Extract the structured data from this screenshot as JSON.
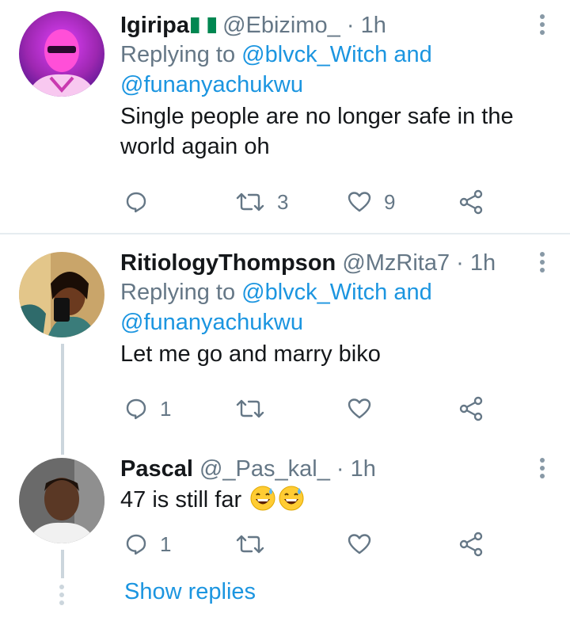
{
  "tweets": [
    {
      "name": "Igiripa",
      "handle": "@Ebizimo_",
      "separator": "·",
      "time": "1h",
      "replying_prefix": "Replying to",
      "mention1": "@blvck_Witch",
      "and": "and",
      "mention2": "@funanyachukwu",
      "text_line1": "Single people are no longer safe in the",
      "text_line2": "world again oh",
      "reply_count": "",
      "retweet_count": "3",
      "like_count": "9",
      "flag": "nigeria-flag-emoji"
    },
    {
      "name": "RitiologyThompson",
      "handle": "@MzRita7",
      "separator": "·",
      "time": "1h",
      "replying_prefix": "Replying to",
      "mention1": "@blvck_Witch",
      "and": "and",
      "mention2": "@funanyachukwu",
      "text": "Let me go and marry biko",
      "reply_count": "1",
      "retweet_count": "",
      "like_count": ""
    },
    {
      "name": "Pascal",
      "handle": "@_Pas_kal_",
      "separator": "·",
      "time": "1h",
      "text": "47 is still far",
      "emojis": [
        "grinning-sweat-emoji",
        "grinning-sweat-emoji"
      ],
      "reply_count": "1",
      "retweet_count": "",
      "like_count": ""
    }
  ],
  "show_replies": "Show replies",
  "colors": {
    "link": "#1b95e0",
    "secondary": "#657786",
    "divider": "#e6ecf0",
    "thread_line": "#ccd6dd"
  }
}
